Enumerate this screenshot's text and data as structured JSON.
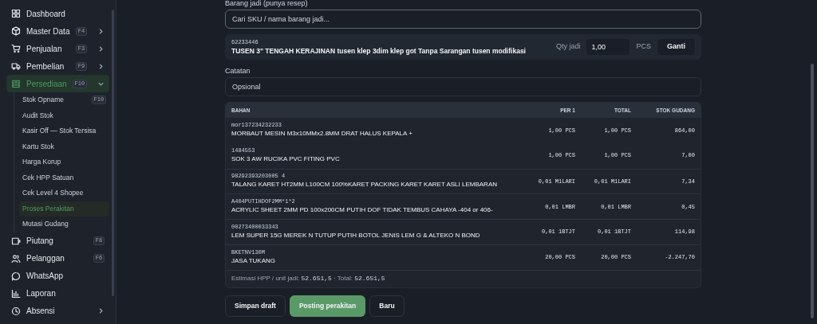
{
  "sidebar": {
    "items": [
      {
        "label": "Dashboard",
        "selected": false
      },
      {
        "label": "Master Data",
        "shortcut": "F4",
        "expanded": false,
        "selected": false
      },
      {
        "label": "Penjualan",
        "shortcut": "F3",
        "expanded": false,
        "selected": false
      },
      {
        "label": "Pembelian",
        "shortcut": "F9",
        "expanded": false,
        "selected": false
      },
      {
        "label": "Persediaan",
        "shortcut": "F10",
        "expanded": true,
        "selected": true,
        "children": [
          {
            "label": "Stok Opname",
            "shortcut": "F10",
            "selected": false
          },
          {
            "label": "Audit Stok",
            "selected": false
          },
          {
            "label": "Kasir Off — Stok Tersisa",
            "selected": false
          },
          {
            "label": "Kartu Stok",
            "selected": false
          },
          {
            "label": "Harga Korup",
            "selected": false
          },
          {
            "label": "Cek HPP Satuan",
            "selected": false
          },
          {
            "label": "Cek Level 4 Shopee",
            "selected": false
          },
          {
            "label": "Proses Perakitan",
            "selected": true
          },
          {
            "label": "Mutasi Gudang",
            "selected": false
          }
        ]
      },
      {
        "label": "Piutang",
        "shortcut": "F8",
        "selected": false
      },
      {
        "label": "Pelanggan",
        "shortcut": "F6",
        "selected": false
      },
      {
        "label": "WhatsApp",
        "selected": false
      },
      {
        "label": "Laporan",
        "selected": false
      },
      {
        "label": "Absensi",
        "expanded": false,
        "selected": false
      }
    ]
  },
  "finished_good": {
    "label": "Barang jadi (punya resep)",
    "search": {
      "placeholder": "Cari SKU / nama barang jadi..."
    },
    "sku": "62233446",
    "name": "TUSEN 3\" TENGAH KERAJINAN tusen klep 3dim klep got Tanpa Sarangan tusen modifikasi",
    "qty_label": "Qty jadi",
    "qty": "1,00",
    "unit": "PCS",
    "change_button": "Ganti"
  },
  "notes": {
    "label": "Catatan",
    "placeholder": "Opsional"
  },
  "table": {
    "columns": [
      "BAHAN",
      "PER 1",
      "TOTAL",
      "STOK GUDANG"
    ],
    "rows": [
      {
        "code": "mor137234232233",
        "name": "MORBAUT MESIN M3x10MMx2.8MM DRAT HALUS KEPALA +",
        "per1": "1,00 PCS",
        "total": "1,00 PCS",
        "stock": "864,00"
      },
      {
        "code": "1484553",
        "name": "SOK 3 AW RUCIKA PVC FITING PVC",
        "per1": "1,00 PCS",
        "total": "1,00 PCS",
        "stock": "7,00"
      },
      {
        "code": "98292393203005 4",
        "name": "TALANG KARET HT2MM L100CM 100%KARET PACKING KARET KARET ASLI LEMBARAN",
        "per1": "0,01 M1LARI",
        "total": "0,01 M1LARI",
        "stock": "7,34"
      },
      {
        "code": "A404PUTIHDOF2MM*1*2",
        "name": "ACRYLIC SHEET 2MM PD 100x200CM PUTIH DOF TIDAK TEMBUS CAHAYA -404 or 406-",
        "per1": "0,01 LMBR",
        "total": "0,01 LMBR",
        "stock": "0,45"
      },
      {
        "code": "00273400033343",
        "name": "LEM SUPER 15G MEREK N TUTUP PUTIH BOTOL JENIS LEM G & ALTEKO N BOND",
        "per1": "0,01 1BTJT",
        "total": "0,01 1BTJT",
        "stock": "114,98"
      },
      {
        "code": "BKETNV130M",
        "name": "JASA TUKANG",
        "per1": "20,00 PCS",
        "total": "20,00 PCS",
        "stock": "-2.247,70"
      }
    ],
    "estimate_label": "Estimasi HPP / unit jadi:",
    "estimate_unit": "52.651,5",
    "total_label": "· Total:",
    "estimate_total": "52.651,5"
  },
  "buttons": [
    {
      "label": "Simpan draft",
      "kind": "secondary"
    },
    {
      "label": "Posting perakitan",
      "kind": "primary"
    },
    {
      "label": "Baru",
      "kind": "secondary"
    }
  ]
}
